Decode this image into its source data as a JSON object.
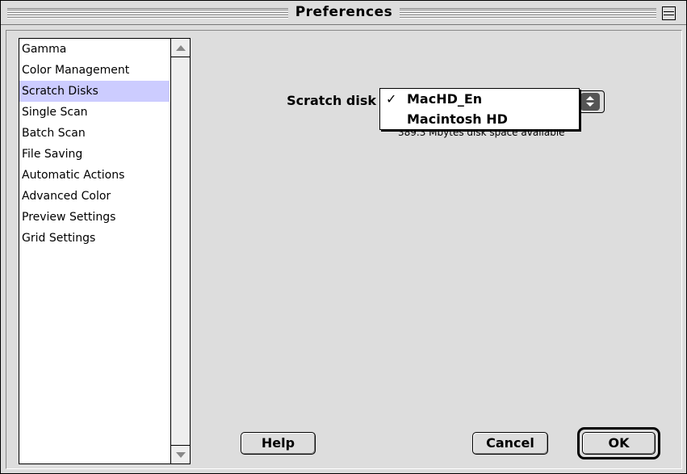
{
  "window": {
    "title": "Preferences"
  },
  "sidebar": {
    "items": [
      {
        "label": "Gamma",
        "selected": false
      },
      {
        "label": "Color Management",
        "selected": false
      },
      {
        "label": "Scratch Disks",
        "selected": true
      },
      {
        "label": "Single Scan",
        "selected": false
      },
      {
        "label": "Batch Scan",
        "selected": false
      },
      {
        "label": "File Saving",
        "selected": false
      },
      {
        "label": "Automatic Actions",
        "selected": false
      },
      {
        "label": "Advanced Color",
        "selected": false
      },
      {
        "label": "Preview Settings",
        "selected": false
      },
      {
        "label": "Grid Settings",
        "selected": false
      }
    ]
  },
  "scratch": {
    "label": "Scratch disk",
    "options": [
      {
        "label": "MacHD_En",
        "checked": true,
        "check_glyph": "✓"
      },
      {
        "label": "Macintosh HD",
        "checked": false,
        "check_glyph": ""
      }
    ],
    "space_text": "389.3 Mbytes disk space available"
  },
  "buttons": {
    "help": "Help",
    "cancel": "Cancel",
    "ok": "OK"
  },
  "colors": {
    "background": "#dddddd",
    "selection": "#ccccff"
  },
  "icons": {
    "collapse": "collapse-box-icon",
    "scroll_up": "scroll-up-arrow-icon",
    "scroll_down": "scroll-down-arrow-icon",
    "popup": "popup-arrows-icon",
    "check": "checkmark-icon"
  }
}
